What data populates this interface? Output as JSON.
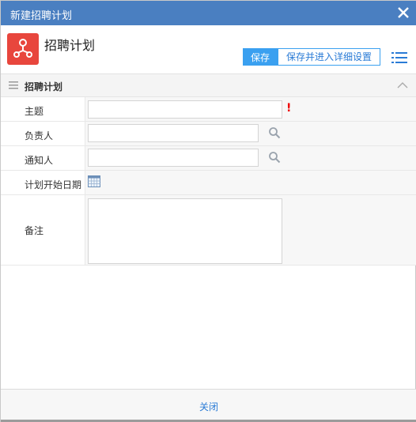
{
  "window": {
    "title": "新建招聘计划"
  },
  "header": {
    "title": "招聘计划",
    "save_label": "保存",
    "save_detail_label": "保存并进入详细设置"
  },
  "section": {
    "title": "招聘计划"
  },
  "form": {
    "subject_label": "主题",
    "subject_value": "",
    "owner_label": "负责人",
    "owner_value": "",
    "notify_label": "通知人",
    "notify_value": "",
    "start_date_label": "计划开始日期",
    "remark_label": "备注",
    "remark_value": "",
    "required_mark": "!"
  },
  "footer": {
    "close_label": "关闭"
  },
  "colors": {
    "titlebar": "#4a7fc1",
    "accent": "#3aa0f0",
    "app_icon": "#e8463d",
    "required": "#ee0000"
  },
  "icons": [
    "close-icon",
    "app-icon",
    "menu-icon",
    "lines-icon",
    "chevron-up-icon",
    "search-icon",
    "calendar-icon"
  ]
}
